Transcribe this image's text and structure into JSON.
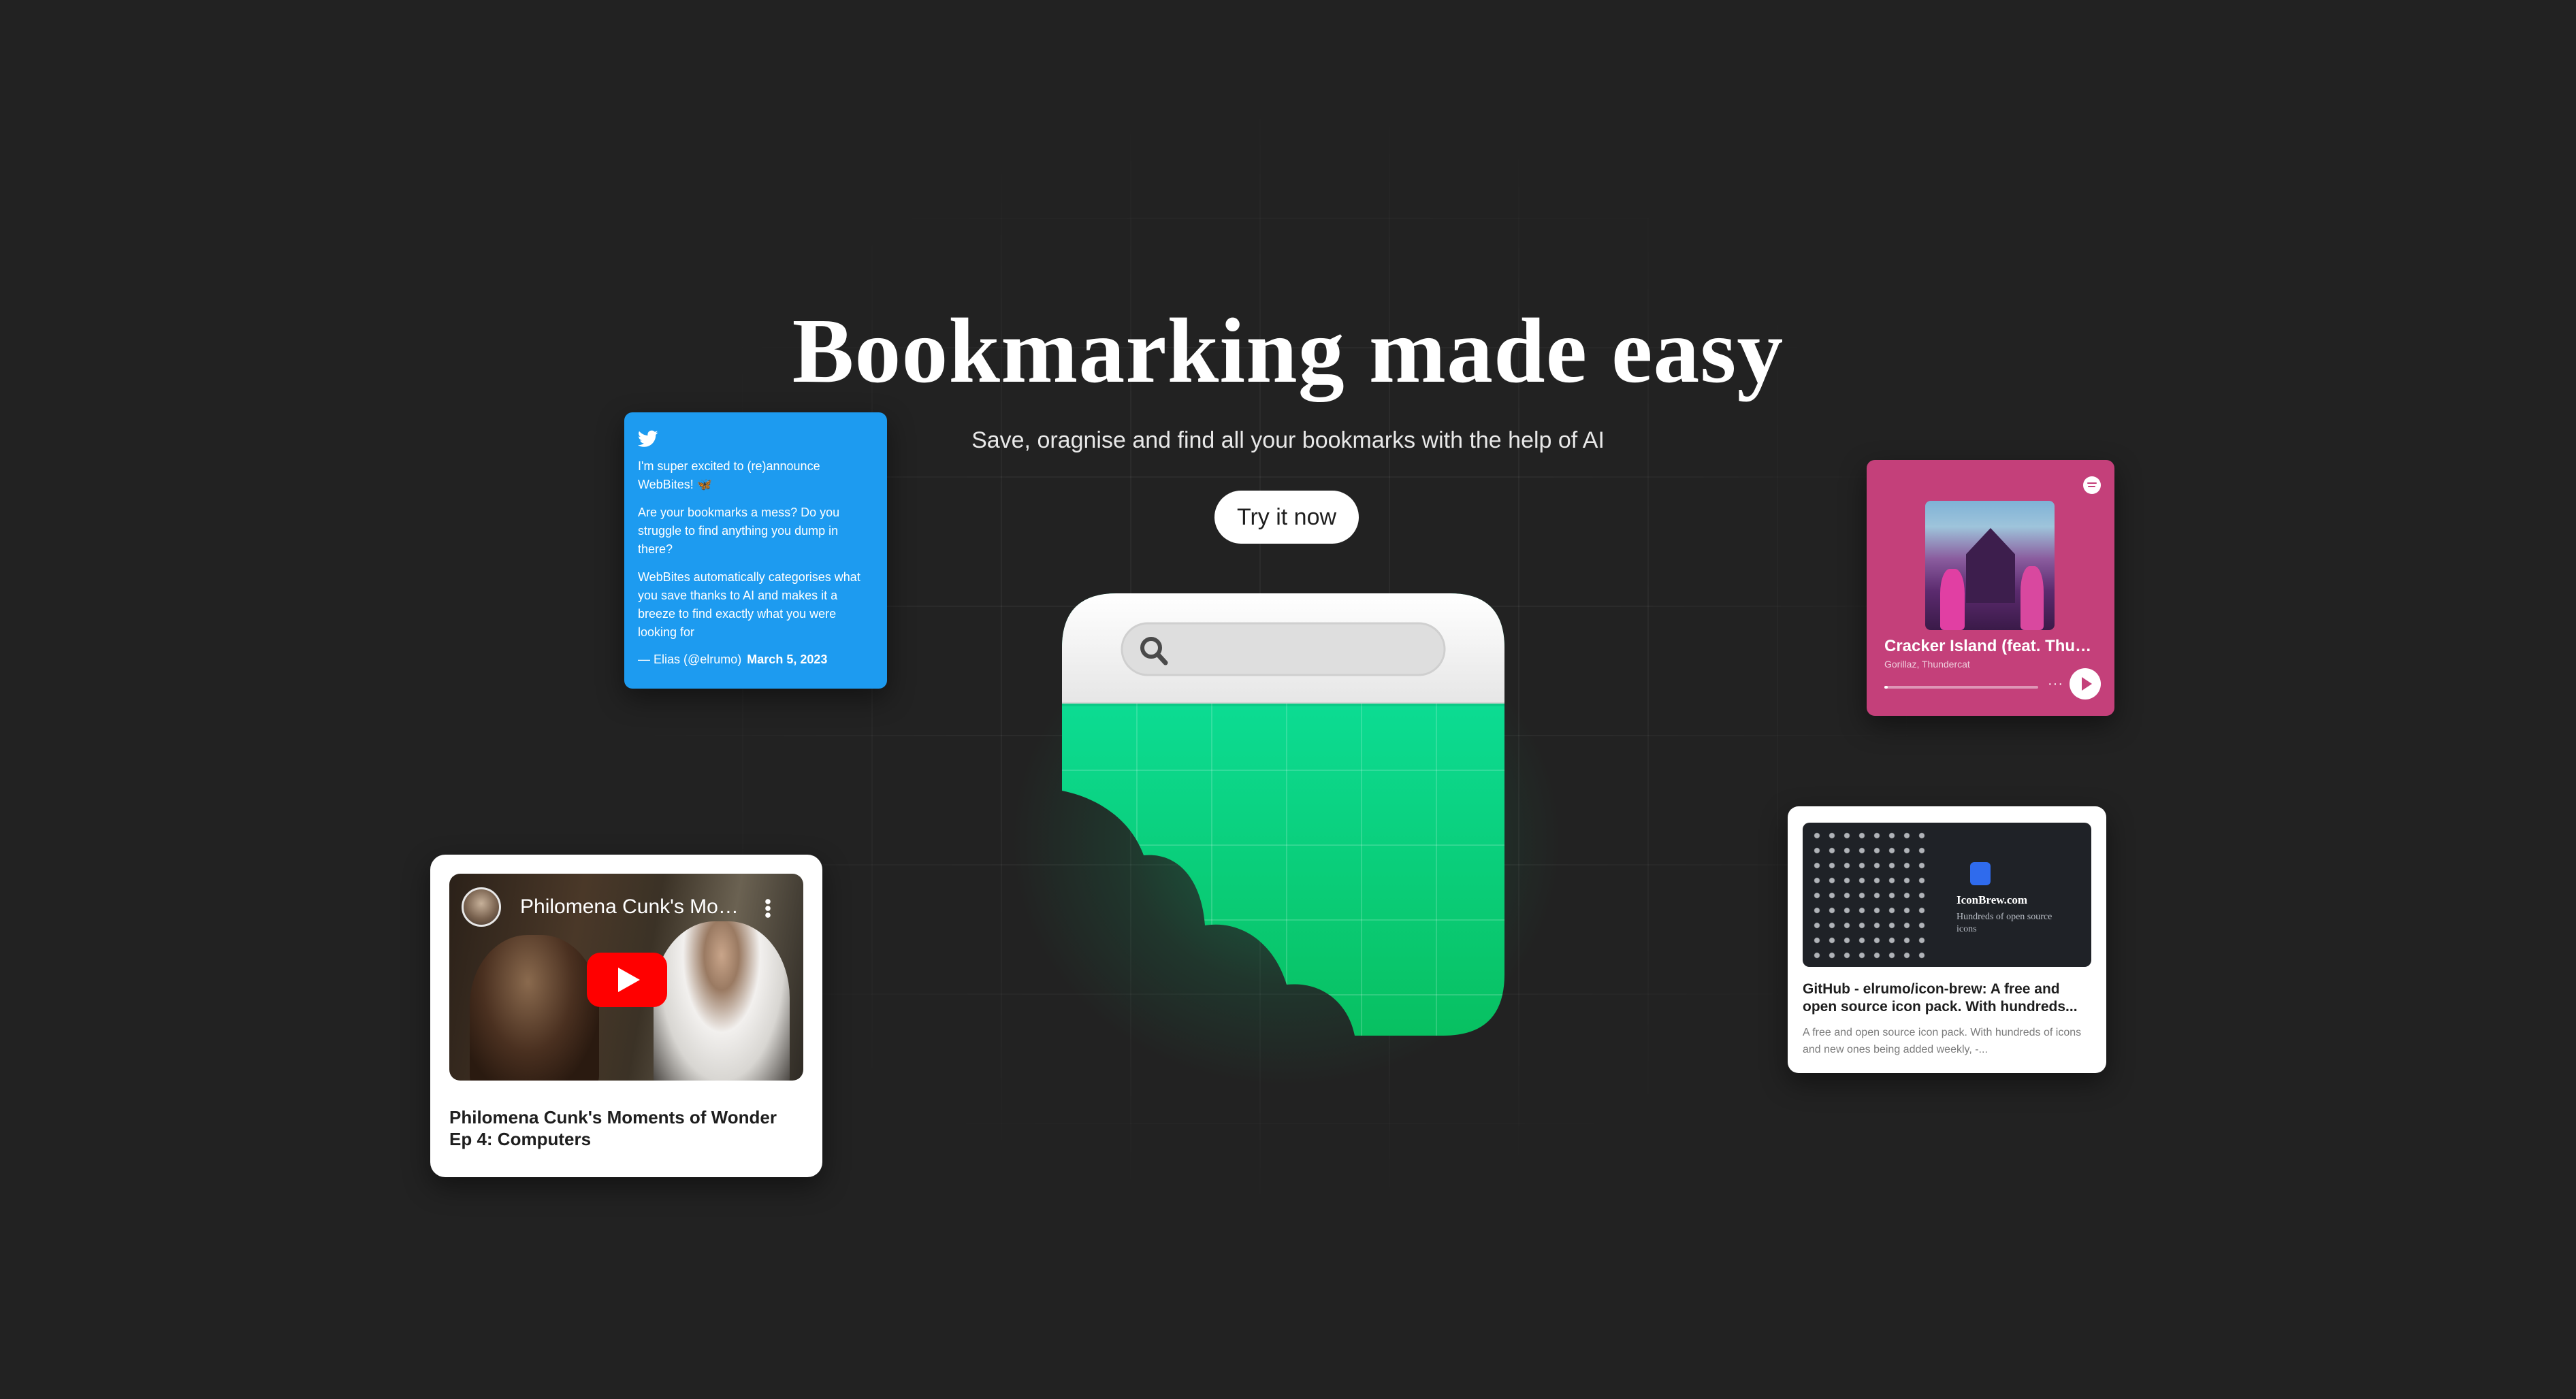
{
  "hero": {
    "headline": "Bookmarking made easy",
    "subtitle": "Save, oragnise and find all your bookmarks with the help of AI",
    "cta_label": "Try it now"
  },
  "colors": {
    "background": "#222222",
    "accent_green": "#0ee39a",
    "tweet_blue": "#1d9bf0",
    "spotify_pink": "#c4407a"
  },
  "tweet_card": {
    "icon": "twitter-bird-icon",
    "paragraphs": [
      "I'm super excited to (re)announce WebBites! 🦋",
      "Are your bookmarks a mess? Do you struggle to find anything you dump in there?",
      "WebBites automatically categorises what you save thanks to AI and makes it a breeze to find exactly what you were looking for"
    ],
    "author": "— Elias (@elrumo)",
    "date": "March 5, 2023"
  },
  "youtube_card": {
    "video_title": "Philomena Cunk's Moments of Wonder",
    "caption": "Philomena Cunk's Moments of Wonder Ep 4: Computers"
  },
  "spotify_card": {
    "track": "Cracker Island (feat. Thundercat)",
    "artist": "Gorillaz, Thundercat",
    "progress": 0.02,
    "more_label": "···"
  },
  "github_card": {
    "preview_brand": "IconBrew.com",
    "preview_subtitle": "Hundreds of open source icons",
    "title": "GitHub - elrumo/icon-brew: A free and open source icon pack. With hundreds...",
    "description": "A free and open source icon pack. With hundreds of icons and new ones being added weekly, -..."
  }
}
